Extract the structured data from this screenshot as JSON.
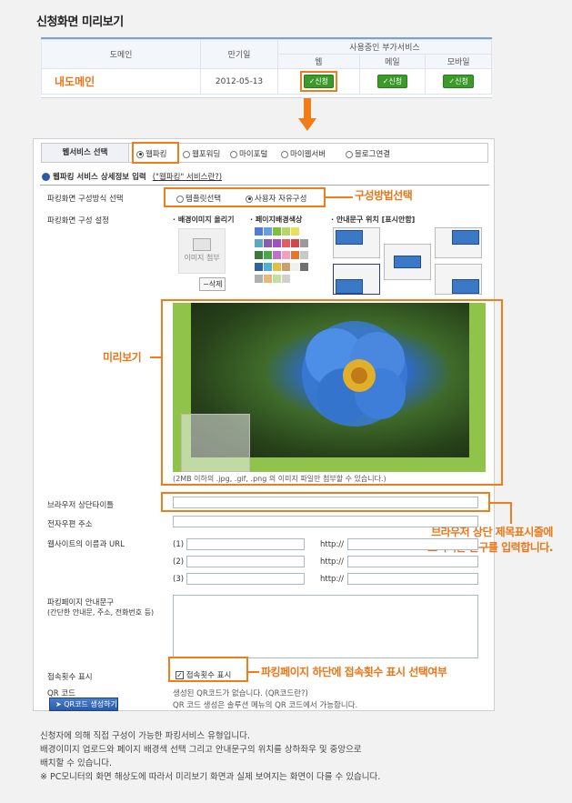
{
  "page_title": "신청화면 미리보기",
  "domain_table": {
    "headers": {
      "domain": "도메인",
      "expiry": "만기일",
      "addon": "사용중인 부가서비스",
      "web": "웹",
      "mail": "메일",
      "mobile": "모바일"
    },
    "row": {
      "domain": "내도메인",
      "expiry": "2012-05-13",
      "web_btn": "신청",
      "mail_btn": "신청",
      "mobile_btn": "신청"
    }
  },
  "service_tabs": {
    "label": "웹서비스 선택",
    "options": [
      "웹파킹",
      "웹포워딩",
      "마이포털",
      "마이웹서버",
      "블로그연결"
    ],
    "selected": "웹파킹"
  },
  "section": {
    "title": "웹파킹 서비스 상세정보 입력",
    "link": "(\"웹파킹\" 서비스란?)"
  },
  "config_method": {
    "label": "파킹화면 구성방식 선택",
    "options": [
      "템플릿선택",
      "사용자 자유구성"
    ],
    "selected": "사용자 자유구성",
    "annotation": "구성방법선택"
  },
  "config_setting": {
    "label": "파킹화면 구성 설정",
    "bg_image_label": "· 배경이미지 올리기",
    "attach_label": "이미지 첨부",
    "delete_label": "삭제",
    "bg_color_label": "· 페이지배경색상",
    "guide_pos_label": "· 안내문구 위치",
    "hide_label": "[표시안함]"
  },
  "swatch_colors": [
    "#4a7fd4",
    "#6a9de0",
    "#7fbf3a",
    "#b6d66a",
    "#e8e05a",
    "#ffffff",
    "#5aa8c8",
    "#8c5aa8",
    "#a050c0",
    "#e06060",
    "#d04848",
    "#9a9a9a",
    "#3a7a3a",
    "#4aa84a",
    "#c070c8",
    "#f0a0c0",
    "#e07830",
    "#c8c8c8",
    "#3060a0",
    "#50b0d0",
    "#e0c040",
    "#c8a070",
    "#f0f0f0",
    "#707070",
    "#b0b0b0",
    "#e8b878",
    "#c0e0a0",
    "#d0d0d0"
  ],
  "preview": {
    "annotation": "미리보기",
    "caption": "(2MB 이하의 .jpg, .gif, .png 의 이미지 파일만 첨부할 수 있습니다.)"
  },
  "fields": {
    "browser_title": "브라우저 상단타이틀",
    "email": "전자우편 주소",
    "site_urls": "웹사이트의 이름과 URL",
    "rows": [
      "(1)",
      "(2)",
      "(3)"
    ],
    "http": "http://",
    "guide_label": "파킹페이지 안내문구",
    "guide_sub": "(간단한 안내문, 주소, 전화번호 등)",
    "counter_label": "접속횟수 표시",
    "counter_check": "접속횟수 표시",
    "qr_label": "QR 코드",
    "qr_button": "QR코드 생성하기",
    "qr_msg1": "생성된 QR코드가 없습니다. (QR코드란?)",
    "qr_msg2": "QR 코드 생성은 솔루션 메뉴의 QR 코드에서 가능합니다."
  },
  "annotations": {
    "title_line1": "브라우저 상단 제목표시줄에",
    "title_line2": "보여지는 문구를 입력합니다.",
    "counter": "파킹페이지 하단에 접속횟수 표시 선택여부"
  },
  "footer": [
    "신청자에 의해 직접 구성이 가능한 파킹서비스 유형입니다.",
    "배경이미지 업로드와 페이지 배경색 선택 그리고 안내문구의 위치를 상하좌우 및 중앙으로",
    "배치할 수 있습니다.",
    "※  PC모니터의 화면 해상도에 따라서 미리보기 화면과 실제 보여지는 화면이 다를 수 있습니다."
  ],
  "accent": "#f07d1a"
}
